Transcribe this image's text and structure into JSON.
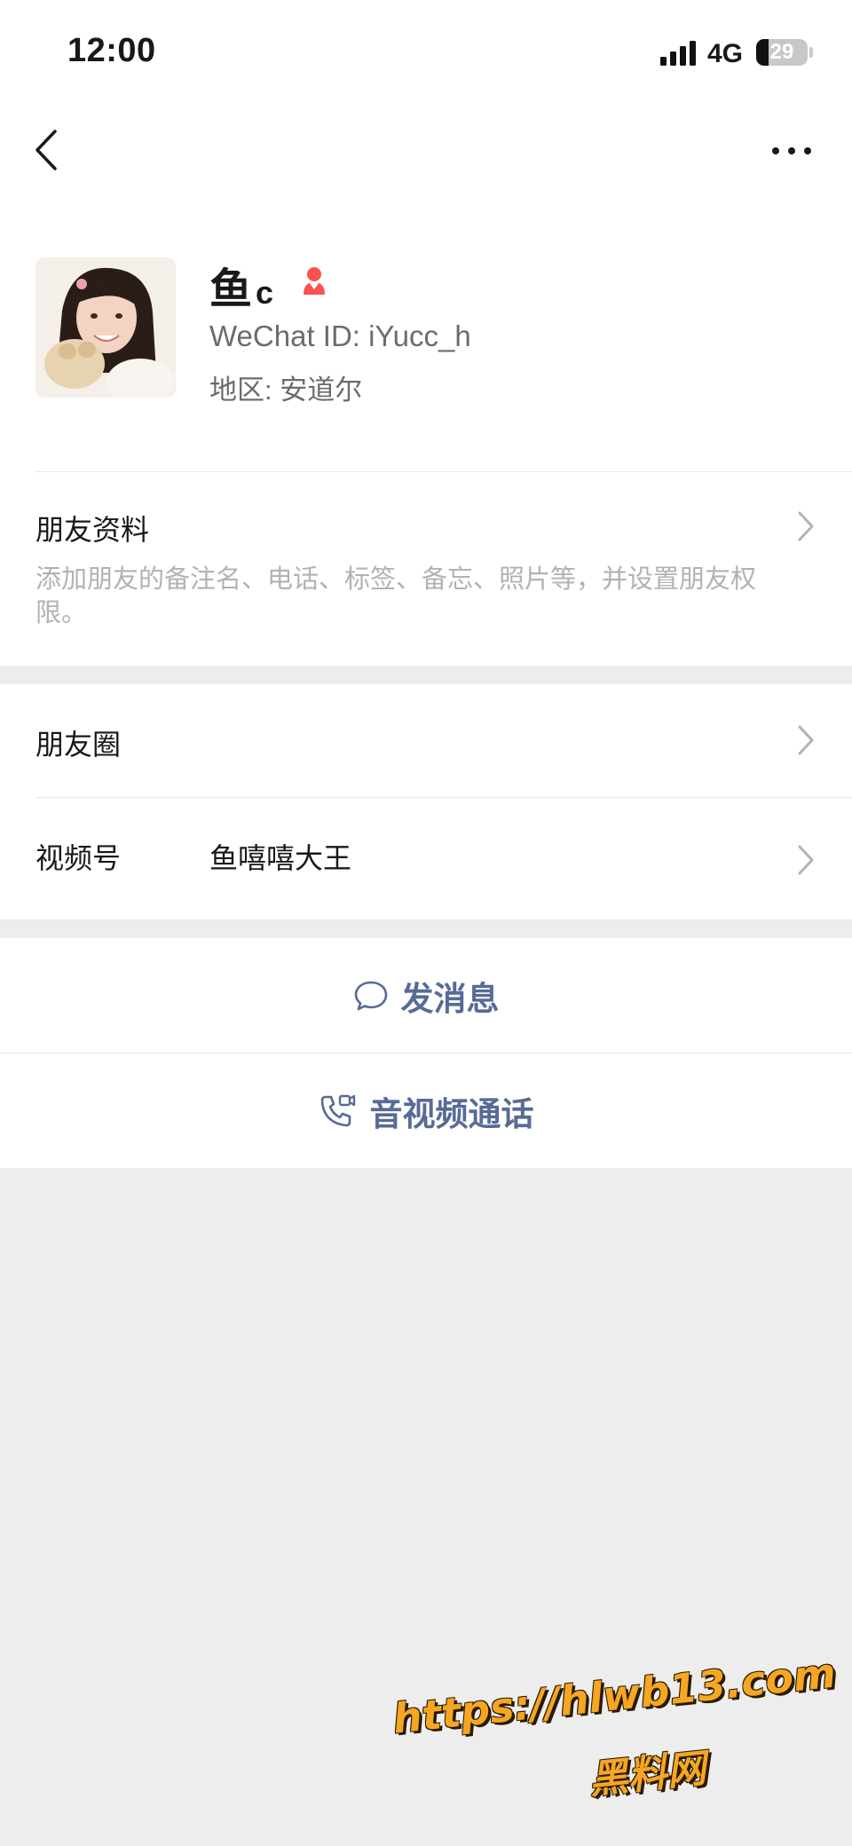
{
  "status_bar": {
    "time": "12:00",
    "network": "4G",
    "battery": "29"
  },
  "nav": {
    "back_icon": "chevron-left-icon",
    "more_icon": "more-dots-icon"
  },
  "profile": {
    "name": "鱼",
    "name_suffix": "c",
    "gender_icon": "female-icon",
    "gender_color": "#fa5151",
    "wechat_id": "WeChat ID: iYucc_h",
    "region": "地区: 安道尔"
  },
  "friend_info": {
    "title": "朋友资料",
    "description": "添加朋友的备注名、电话、标签、备忘、照片等，并设置朋友权限。"
  },
  "moments": {
    "title": "朋友圈"
  },
  "channels": {
    "title": "视频号",
    "value": "鱼嘻嘻大王"
  },
  "actions": {
    "message_label": "发消息",
    "call_label": "音视频通话",
    "accent_color": "#576b95"
  },
  "watermark": {
    "url": "https://hlwb13.com",
    "site": "黑料网"
  }
}
